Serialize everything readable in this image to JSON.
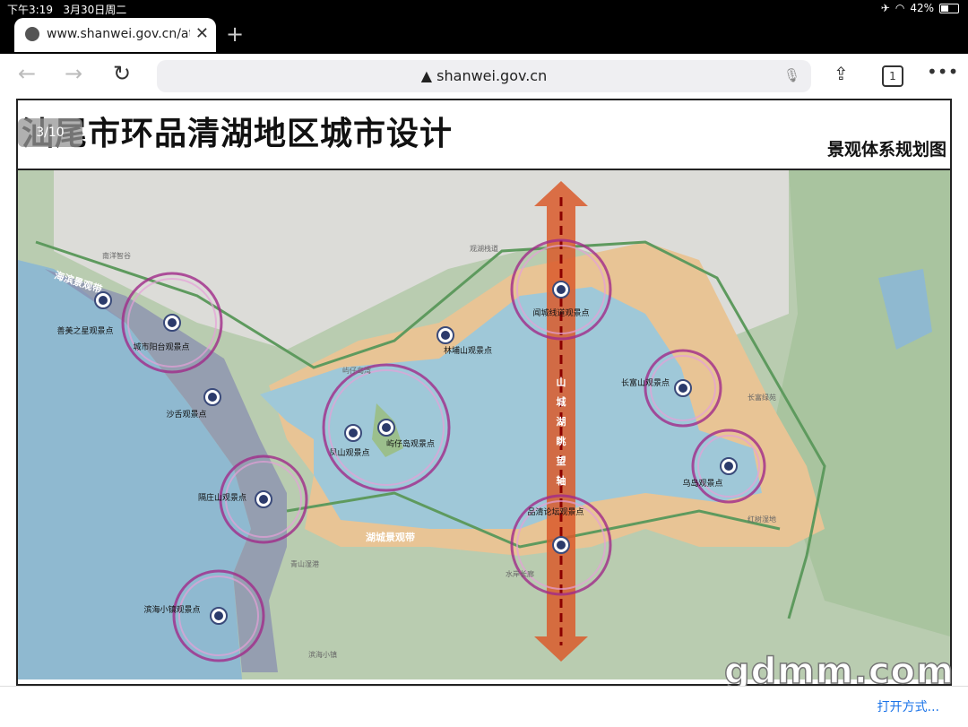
{
  "status_bar": {
    "time": "下午3:19",
    "date": "3月30日周二",
    "battery": "42%",
    "battery_level": 0.42
  },
  "tab": {
    "title": "www.shanwei.gov.cn/atta"
  },
  "url_bar": {
    "url": "shanwei.gov.cn",
    "tab_count": "1"
  },
  "document": {
    "title": "汕尾市环品清湖地区城市设计",
    "subtitle": "景观体系规划图",
    "page_indicator": "3/10"
  },
  "map": {
    "viewpoints": [
      "善美之星观景点",
      "城市阳台观景点",
      "沙舌观景点",
      "隔庄山观景点",
      "滨海小镇观景点",
      "凤山观景点",
      "屿仔岛观景点",
      "林埔山观景点",
      "闻城线道观景点",
      "长富山观景点",
      "乌岛观景点",
      "品清论坛观景点"
    ],
    "place_labels": [
      "南洋智谷",
      "观湖栈道",
      "屿仔岛湾",
      "长富绿苑",
      "红树湿地",
      "水岸长廊",
      "青山湿港",
      "滨海小镇"
    ],
    "belts": {
      "sea": "海滨景观带",
      "lake": "湖城景观带",
      "axis": "山城湖眺望轴"
    }
  },
  "bottom_bar": {
    "open_with": "打开方式..."
  },
  "watermark": "gdmm.com"
}
